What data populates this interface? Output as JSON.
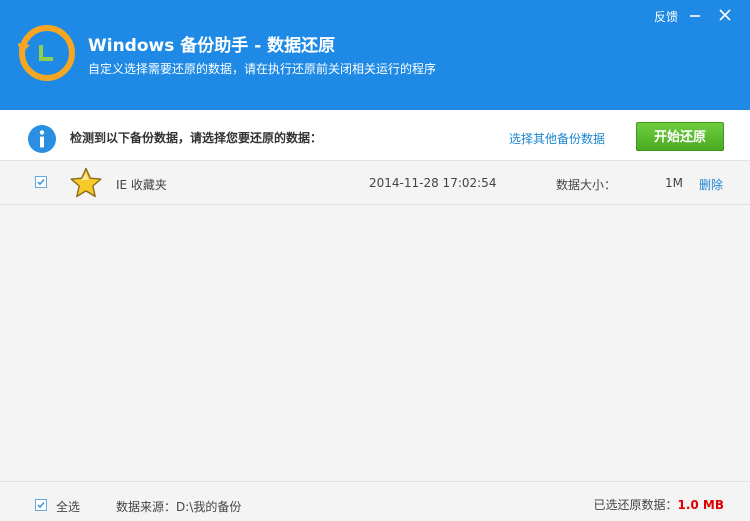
{
  "header": {
    "title": "Windows 备份助手 - 数据还原",
    "subtitle": "自定义选择需要还原的数据，请在执行还原前关闭相关运行的程序",
    "feedback": "反馈",
    "bg_color": "#1e8ae6"
  },
  "toolbar": {
    "prompt": "检测到以下备份数据，请选择您要还原的数据：",
    "other_backup_link": "选择其他备份数据",
    "start_button": "开始还原"
  },
  "items": [
    {
      "name": "IE 收藏夹",
      "date": "2014-11-28 17:02:54",
      "size_label": "数据大小：",
      "size": "1M",
      "delete": "删除",
      "checked": true,
      "icon": "star-icon"
    }
  ],
  "footer": {
    "select_all": "全选",
    "source": "数据来源：D:\\我的备份",
    "restored_label": "已选还原数据：",
    "restored_value": "1.0 MB"
  }
}
